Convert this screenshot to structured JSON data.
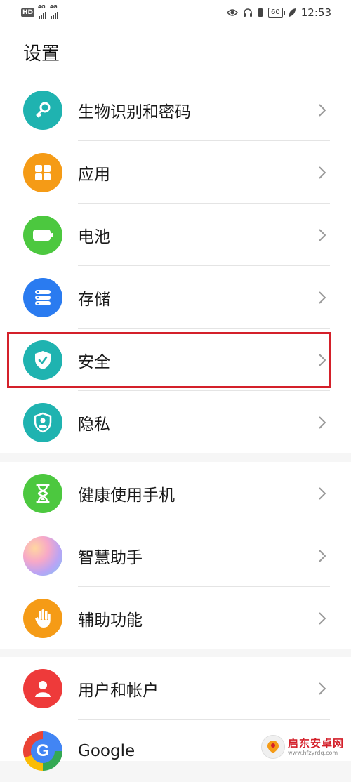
{
  "status_bar": {
    "hd": "HD",
    "net1": "4G",
    "net2": "4G",
    "battery": "60",
    "time": "12:53"
  },
  "header": {
    "title": "设置"
  },
  "groups": [
    {
      "items": [
        {
          "label": "生物识别和密码",
          "icon": "key-icon",
          "color": "#1fb3b0"
        },
        {
          "label": "应用",
          "icon": "apps-grid-icon",
          "color": "#f59b16"
        },
        {
          "label": "电池",
          "icon": "battery-icon",
          "color": "#4cc83f"
        },
        {
          "label": "存储",
          "icon": "storage-icon",
          "color": "#2a7bf0"
        },
        {
          "label": "安全",
          "icon": "shield-check-icon",
          "color": "#1fb3b0"
        },
        {
          "label": "隐私",
          "icon": "privacy-icon",
          "color": "#1fb3b0"
        }
      ]
    },
    {
      "items": [
        {
          "label": "健康使用手机",
          "icon": "hourglass-icon",
          "color": "#4cc83f"
        },
        {
          "label": "智慧助手",
          "icon": "assistant-icon",
          "color": "#c79cf0"
        },
        {
          "label": "辅助功能",
          "icon": "hand-icon",
          "color": "#f59b16"
        }
      ]
    },
    {
      "items": [
        {
          "label": "用户和帐户",
          "icon": "user-icon",
          "color": "#ee3a3a"
        },
        {
          "label": "Google",
          "icon": "google-icon",
          "color": "#4285f4"
        }
      ]
    }
  ],
  "watermark": {
    "name": "启东安卓网",
    "url": "www.hfzyrdq.com"
  },
  "colors": {
    "highlight": "#d4202a",
    "background": "#f6f6f6",
    "card": "#ffffff"
  }
}
